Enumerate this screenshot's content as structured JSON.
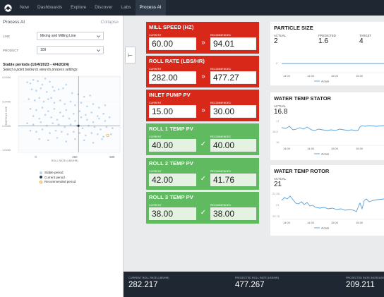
{
  "nav": {
    "items": [
      {
        "label": "Now"
      },
      {
        "label": "Dashboards"
      },
      {
        "label": "Explore"
      },
      {
        "label": "Discover"
      },
      {
        "label": "Labs"
      },
      {
        "label": "Process AI"
      }
    ],
    "active_index": 5
  },
  "left_panel": {
    "title": "Process AI",
    "collapse_label": "Collapse",
    "line_label": "LINE",
    "line_value": "Mixing and Milling Line",
    "product_label": "PRODUCT",
    "product_value": "109",
    "stable_title": "Stable periods (10/4/2023 - 4/4/2024)",
    "stable_sub": "Select a point below to view its process settings",
    "legend": {
      "stable": "Stable period",
      "current": "Current period",
      "recommended": "Recommended period"
    }
  },
  "chart_data": {
    "type": "scatter",
    "xlabel": "ROLL RATE (LBS/HR)",
    "ylabel": "PARTICLE SIZE",
    "x_ticks": [
      "0",
      "250",
      "500"
    ],
    "y_ticks": [
      "1.0000",
      "2.0000",
      "3.0000",
      "4.0000"
    ],
    "xlim": [
      -120,
      560
    ],
    "ylim": [
      0.9,
      4.05
    ],
    "series": [
      {
        "name": "Stable period",
        "color": "#b7d3ec",
        "points": [
          [
            -60,
            3.8
          ],
          [
            -40,
            3.75
          ],
          [
            -20,
            3.9
          ],
          [
            10,
            3.85
          ],
          [
            40,
            3.7
          ],
          [
            60,
            3.95
          ],
          [
            90,
            3.82
          ],
          [
            -30,
            3.5
          ],
          [
            0,
            3.45
          ],
          [
            30,
            3.55
          ],
          [
            70,
            3.4
          ],
          [
            110,
            3.6
          ],
          [
            150,
            3.5
          ],
          [
            200,
            3.7
          ],
          [
            240,
            3.35
          ],
          [
            280,
            3.3
          ],
          [
            320,
            3.2
          ],
          [
            360,
            3.25
          ],
          [
            -50,
            3.1
          ],
          [
            -10,
            3.05
          ],
          [
            20,
            3.15
          ],
          [
            50,
            3.0
          ],
          [
            80,
            3.1
          ],
          [
            120,
            2.95
          ],
          [
            160,
            3.05
          ],
          [
            190,
            2.9
          ],
          [
            230,
            3.0
          ],
          [
            260,
            2.85
          ],
          [
            300,
            2.95
          ],
          [
            340,
            2.8
          ],
          [
            380,
            2.9
          ],
          [
            420,
            2.75
          ],
          [
            460,
            2.85
          ],
          [
            -40,
            2.7
          ],
          [
            0,
            2.65
          ],
          [
            40,
            2.75
          ],
          [
            80,
            2.6
          ],
          [
            120,
            2.7
          ],
          [
            160,
            2.55
          ],
          [
            200,
            2.65
          ],
          [
            250,
            2.5
          ],
          [
            290,
            2.6
          ],
          [
            330,
            2.45
          ],
          [
            370,
            2.55
          ],
          [
            410,
            2.4
          ],
          [
            450,
            2.5
          ],
          [
            490,
            2.35
          ],
          [
            -20,
            2.4
          ],
          [
            20,
            2.3
          ],
          [
            60,
            2.45
          ],
          [
            100,
            2.35
          ],
          [
            140,
            2.25
          ],
          [
            180,
            2.4
          ],
          [
            220,
            2.3
          ],
          [
            260,
            2.2
          ],
          [
            300,
            2.35
          ],
          [
            340,
            2.25
          ],
          [
            380,
            2.15
          ],
          [
            420,
            2.3
          ],
          [
            460,
            2.2
          ],
          [
            -60,
            2.1
          ],
          [
            -20,
            2.05
          ],
          [
            30,
            2.15
          ],
          [
            70,
            2.0
          ],
          [
            110,
            2.1
          ],
          [
            150,
            2.05
          ],
          [
            190,
            1.95
          ],
          [
            230,
            2.05
          ],
          [
            270,
            2.0
          ],
          [
            310,
            1.9
          ],
          [
            350,
            2.0
          ],
          [
            390,
            1.95
          ],
          [
            430,
            1.85
          ],
          [
            470,
            1.95
          ],
          [
            510,
            1.9
          ],
          [
            -40,
            1.8
          ],
          [
            0,
            1.75
          ],
          [
            40,
            1.85
          ],
          [
            90,
            1.7
          ],
          [
            130,
            1.8
          ],
          [
            170,
            1.75
          ],
          [
            210,
            1.65
          ],
          [
            250,
            1.75
          ],
          [
            290,
            1.7
          ],
          [
            330,
            1.6
          ],
          [
            370,
            1.7
          ],
          [
            410,
            1.65
          ],
          [
            450,
            1.55
          ],
          [
            500,
            1.65
          ],
          [
            20,
            1.45
          ],
          [
            80,
            1.4
          ],
          [
            140,
            1.5
          ],
          [
            200,
            1.35
          ],
          [
            260,
            1.45
          ],
          [
            320,
            1.4
          ],
          [
            380,
            1.3
          ],
          [
            440,
            1.45
          ],
          [
            120,
            3.45
          ],
          [
            180,
            3.55
          ],
          [
            100,
            3.15
          ]
        ]
      },
      {
        "name": "Current period",
        "color": "#2b3a4a",
        "points": [
          [
            282.2,
            2.0
          ]
        ]
      },
      {
        "name": "Recommended period",
        "color": "#f0a030",
        "points": [
          [
            477.3,
            1.6
          ]
        ]
      }
    ]
  },
  "tiles": [
    {
      "title": "MILL SPEED (HZ)",
      "current_label": "CURRENT",
      "current": "60.00",
      "rec_label": "RECOMMENDED",
      "recommended": "94.01",
      "status": "red",
      "symbol": "»"
    },
    {
      "title": "ROLL RATE (LBS/HR)",
      "current_label": "CURRENT",
      "current": "282.00",
      "rec_label": "RECOMMENDED",
      "recommended": "477.27",
      "status": "red",
      "symbol": "»"
    },
    {
      "title": "INLET PUMP PV",
      "current_label": "CURRENT",
      "current": "15.00",
      "rec_label": "RECOMMENDED",
      "recommended": "30.00",
      "status": "red",
      "symbol": "»"
    },
    {
      "title": "ROLL 1 TEMP PV",
      "current_label": "CURRENT",
      "current": "40.00",
      "rec_label": "RECOMMENDED",
      "recommended": "40.00",
      "status": "green",
      "symbol": "✓"
    },
    {
      "title": "ROLL 2 TEMP PV",
      "current_label": "CURRENT",
      "current": "42.00",
      "rec_label": "RECOMMENDED",
      "recommended": "41.76",
      "status": "green",
      "symbol": "✓"
    },
    {
      "title": "ROLL 3 TEMP PV",
      "current_label": "CURRENT",
      "current": "38.00",
      "rec_label": "RECOMMENDED",
      "recommended": "38.00",
      "status": "green",
      "symbol": "✓"
    }
  ],
  "cards": {
    "particle": {
      "title": "PARTICLE SIZE",
      "actual_label": "ACTUAL",
      "actual": "2",
      "predicted_label": "PREDICTED",
      "predicted": "1.6",
      "target_label": "TARGET",
      "target": "4",
      "y_tick": "2",
      "x_ticks": [
        "14:00",
        "14:30",
        "15:00",
        "15:30"
      ],
      "legend": "Actual"
    },
    "stator": {
      "title": "WATER TEMP STATOR",
      "actual_label": "ACTUAL",
      "actual": "16.8",
      "y_ticks": [
        "17",
        "16.5",
        "16"
      ],
      "x_ticks": [
        "14:00",
        "14:30",
        "15:00",
        "15:30"
      ],
      "legend": "Actual"
    },
    "rotor": {
      "title": "WATER TEMP ROTOR",
      "actual_label": "ACTUAL",
      "actual": "21",
      "y_ticks": [
        "21.25",
        "21",
        "20.75"
      ],
      "x_ticks": [
        "14:00",
        "14:30",
        "15:00",
        "15:30"
      ],
      "legend": "Actual"
    }
  },
  "bottom": {
    "current_label": "CURRENT ROLL RATE (LBS/HR)",
    "current_value": "282.217",
    "projected_label": "PROJECTED ROLL RATE (LBS/HR)",
    "projected_value": "477.267",
    "increase_label": "PROJECTED RATE INCREASE",
    "increase_value": "209.211"
  },
  "colors": {
    "nav_bg": "#1e2732",
    "alert_red": "#d8281a",
    "ok_green": "#5fba60",
    "line_blue": "#5aa0d8"
  }
}
